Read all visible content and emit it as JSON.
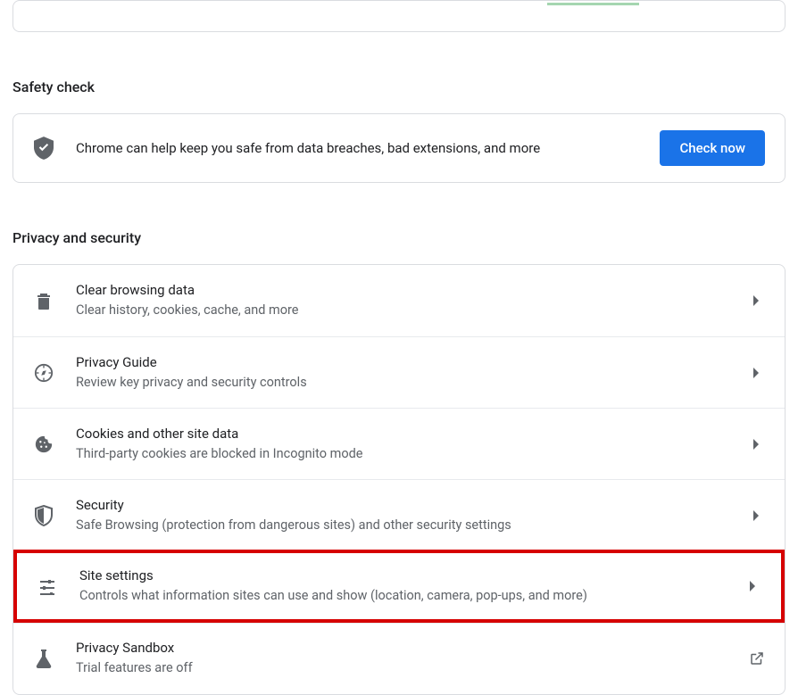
{
  "sections": {
    "safety_title": "Safety check",
    "privacy_title": "Privacy and security"
  },
  "safety": {
    "text": "Chrome can help keep you safe from data breaches, bad extensions, and more",
    "button": "Check now"
  },
  "privacy_rows": [
    {
      "icon": "trash-icon",
      "title": "Clear browsing data",
      "sub": "Clear history, cookies, cache, and more",
      "action": "chevron"
    },
    {
      "icon": "compass-icon",
      "title": "Privacy Guide",
      "sub": "Review key privacy and security controls",
      "action": "chevron"
    },
    {
      "icon": "cookie-icon",
      "title": "Cookies and other site data",
      "sub": "Third-party cookies are blocked in Incognito mode",
      "action": "chevron"
    },
    {
      "icon": "shield-icon",
      "title": "Security",
      "sub": "Safe Browsing (protection from dangerous sites) and other security settings",
      "action": "chevron"
    },
    {
      "icon": "sliders-icon",
      "title": "Site settings",
      "sub": "Controls what information sites can use and show (location, camera, pop-ups, and more)",
      "action": "chevron",
      "highlight": true
    },
    {
      "icon": "flask-icon",
      "title": "Privacy Sandbox",
      "sub": "Trial features are off",
      "action": "external"
    }
  ]
}
